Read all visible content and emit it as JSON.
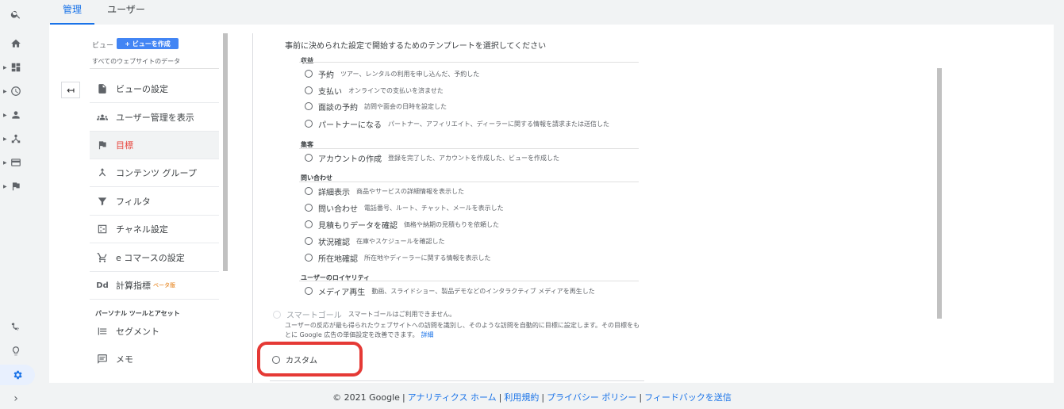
{
  "tabs": [
    {
      "label": "管理"
    },
    {
      "label": "ユーザー"
    }
  ],
  "view": {
    "label": "ビュー",
    "create_button": "+ ビューを作成",
    "name": "すべてのウェブサイトのデータ"
  },
  "menu": [
    {
      "label": "ビューの設定"
    },
    {
      "label": "ユーザー管理を表示"
    },
    {
      "label": "目標"
    },
    {
      "label": "コンテンツ グループ"
    },
    {
      "label": "フィルタ"
    },
    {
      "label": "チャネル設定"
    },
    {
      "label": "e コマースの設定"
    },
    {
      "label": "計算指標",
      "badge": "ベータ版"
    }
  ],
  "personal": {
    "heading": "パーソナル ツールとアセット",
    "items": [
      {
        "label": "セグメント"
      },
      {
        "label": "メモ"
      }
    ]
  },
  "template": {
    "intro": "事前に決められた設定で開始するためのテンプレートを選択してください",
    "groups": [
      {
        "heading": "収益",
        "options": [
          {
            "label": "予約",
            "desc": "ツアー、レンタルの利用を申し込んだ、予約した"
          },
          {
            "label": "支払い",
            "desc": "オンラインでの支払いを済ませた"
          },
          {
            "label": "面談の予約",
            "desc": "訪問や面会の日時を設定した"
          },
          {
            "label": "パートナーになる",
            "desc": "パートナー、アフィリエイト、ディーラーに関する情報を請求または送信した"
          }
        ]
      },
      {
        "heading": "集客",
        "options": [
          {
            "label": "アカウントの作成",
            "desc": "登録を完了した、アカウントを作成した、ビューを作成した"
          }
        ]
      },
      {
        "heading": "問い合わせ",
        "options": [
          {
            "label": "詳細表示",
            "desc": "商品やサービスの詳細情報を表示した"
          },
          {
            "label": "問い合わせ",
            "desc": "電話番号、ルート、チャット、メールを表示した"
          },
          {
            "label": "見積もりデータを確認",
            "desc": "価格や納期の見積もりを依頼した"
          },
          {
            "label": "状況確認",
            "desc": "在庫やスケジュールを確認した"
          },
          {
            "label": "所在地確認",
            "desc": "所在地やディーラーに関する情報を表示した"
          }
        ]
      },
      {
        "heading": "ユーザーのロイヤリティ",
        "options": [
          {
            "label": "メディア再生",
            "desc": "動画、スライドショー、製品デモなどのインタラクティブ メディアを再生した"
          }
        ]
      }
    ]
  },
  "smart_goal": {
    "label": "スマートゴール",
    "desc": "スマートゴールはご利用できません。",
    "note": "ユーザーの反応が最も得られたウェブサイトへの訪問を識別し、そのような訪問を自動的に目標に設定します。その目標をもとに Google 広告の単価設定を改善できます。",
    "link": "詳細"
  },
  "custom": {
    "label": "カスタム"
  },
  "footer": {
    "copyright": "© 2021 Google",
    "links": [
      "アナリティクス ホーム",
      "利用規約",
      "プライバシー ポリシー",
      "フィードバックを送信"
    ]
  },
  "colors": {
    "accent": "#1a73e8",
    "selected_text": "#e8453c",
    "highlight_box": "#e53935",
    "create_button": "#4285f4"
  }
}
